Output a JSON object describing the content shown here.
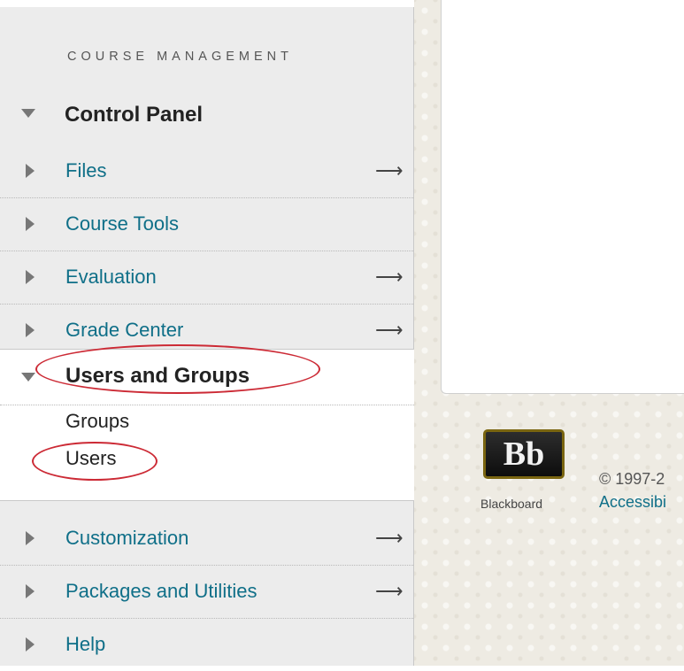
{
  "sidebar": {
    "section_header": "COURSE MANAGEMENT",
    "control_panel_label": "Control Panel",
    "items_before": [
      {
        "label": "Files",
        "arrow": "⟶"
      },
      {
        "label": "Course Tools",
        "arrow": ""
      },
      {
        "label": "Evaluation",
        "arrow": "⟶"
      },
      {
        "label": "Grade Center",
        "arrow": "⟶"
      }
    ],
    "expanded": {
      "label": "Users and Groups",
      "subitems": [
        "Groups",
        "Users"
      ]
    },
    "items_after": [
      {
        "label": "Customization",
        "arrow": "⟶"
      },
      {
        "label": "Packages and Utilities",
        "arrow": "⟶"
      },
      {
        "label": "Help",
        "arrow": ""
      }
    ]
  },
  "footer": {
    "logo_text": "Bb",
    "brand_name": "Blackboard",
    "copyright": "© 1997-2",
    "accessibility_link": "Accessibi"
  },
  "annotations": {
    "highlight_color": "#cc2a35"
  },
  "icons": [
    "triangle-down-icon",
    "triangle-right-icon",
    "arrow-right-icon",
    "blackboard-logo"
  ]
}
